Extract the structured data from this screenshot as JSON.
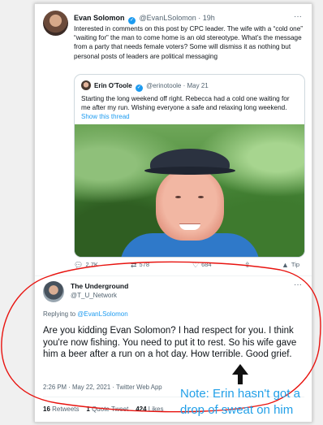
{
  "tweet": {
    "author_name": "Evan Solomon",
    "author_handle": "@EvanLSolomon",
    "time": "19h",
    "text": "Interested in comments on this post by CPC leader. The wife with a “cold one”  “waiting for” the man to come home is an old stereotype. What’s the message from a party that needs female voters? Some will dismiss it as nothing but personal posts of leaders are political messaging",
    "more_icon": "more-dots-icon",
    "quoted": {
      "author_name": "Erin O'Toole",
      "author_handle": "@erinotoole",
      "date": "May 21",
      "text": "Starting the long weekend off right. Rebecca had a cold one waiting for me after my run. Wishing everyone a safe and relaxing long weekend.",
      "show_thread": "Show this thread"
    },
    "actions": {
      "replies": "2.7K",
      "retweets": "578",
      "likes": "684",
      "share_icon": "share-icon",
      "tip": "Tip"
    }
  },
  "reply": {
    "author_name": "The Underground",
    "author_handle": "@T_U_Network",
    "replying_prefix": "Replying to",
    "replying_mention": "@EvanLSolomon",
    "text": "Are you kidding Evan Solomon?  I had respect for you. I think you're now fishing.  You need to put it to rest. So his wife gave him a beer after a run on a hot day. How terrible.  Good grief.",
    "timestamp": "2:26 PM · May 22, 2021 · Twitter Web App",
    "retweets_count": "16",
    "retweets_label": "Retweets",
    "quote_count": "1",
    "quote_label": "Quote Tweet",
    "likes_count": "424",
    "likes_label": "Likes"
  },
  "annotation": {
    "note_line1": "Note: Erin hasn't got a",
    "note_line2": "drop of sweat on him",
    "circle_color": "#e8130f",
    "note_color": "#22a0e8",
    "arrow_icon": "up-arrow-icon"
  },
  "colors": {
    "link": "#1d9bf0",
    "text": "#0f1419",
    "muted": "#536471"
  }
}
